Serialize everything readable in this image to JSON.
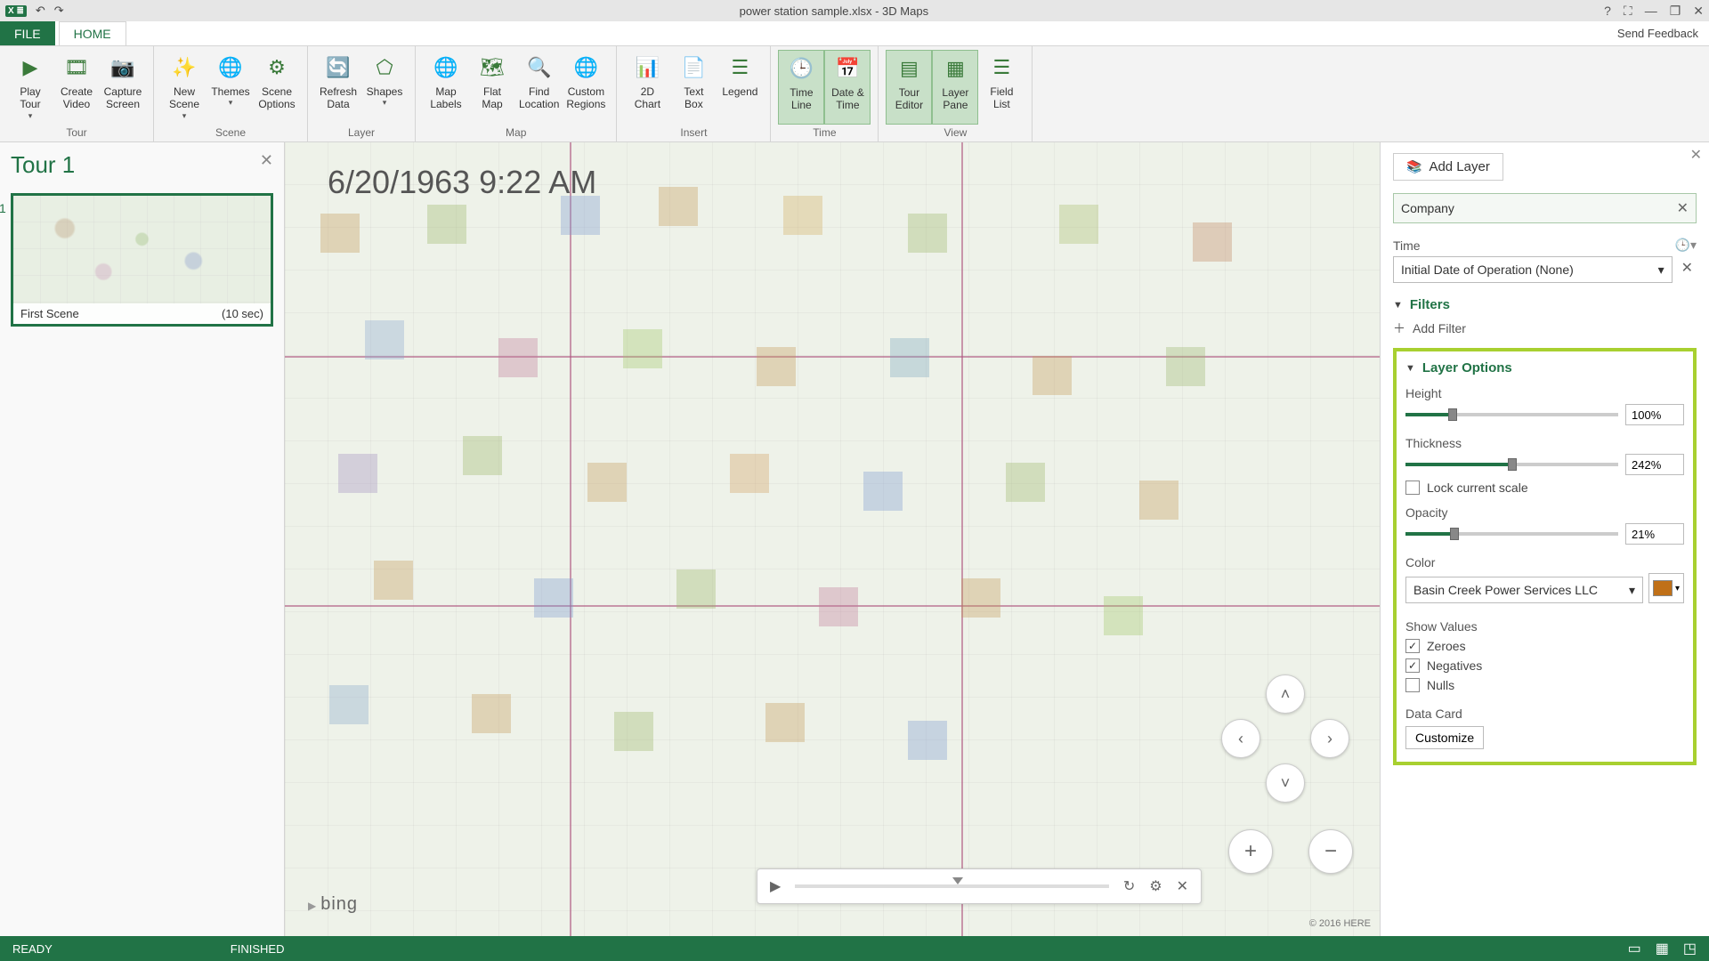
{
  "titlebar": {
    "title": "power station sample.xlsx - 3D Maps"
  },
  "tabs": {
    "file": "FILE",
    "home": "HOME",
    "feedback": "Send Feedback"
  },
  "ribbon": {
    "tour": {
      "label": "Tour",
      "play": "Play\nTour",
      "create": "Create\nVideo",
      "capture": "Capture\nScreen"
    },
    "scene": {
      "label": "Scene",
      "new": "New\nScene",
      "themes": "Themes",
      "options": "Scene\nOptions"
    },
    "layer": {
      "label": "Layer",
      "refresh": "Refresh\nData",
      "shapes": "Shapes"
    },
    "map": {
      "label": "Map",
      "labels": "Map\nLabels",
      "flat": "Flat\nMap",
      "find": "Find\nLocation",
      "custom": "Custom\nRegions"
    },
    "insert": {
      "label": "Insert",
      "chart": "2D\nChart",
      "text": "Text\nBox",
      "legend": "Legend"
    },
    "time": {
      "label": "Time",
      "timeline": "Time\nLine",
      "datetime": "Date &\nTime"
    },
    "view": {
      "label": "View",
      "editor": "Tour\nEditor",
      "pane": "Layer\nPane",
      "list": "Field\nList"
    }
  },
  "tourpanel": {
    "title": "Tour 1",
    "scene_num": "1",
    "scene_name": "First Scene",
    "scene_dur": "(10 sec)"
  },
  "map": {
    "datestamp": "6/20/1963 9:22 AM",
    "bing": "bing",
    "copyright": "© 2016 HERE"
  },
  "layer": {
    "add": "Add Layer",
    "company": "Company",
    "time_lbl": "Time",
    "time_field": "Initial Date of Operation (None)",
    "filters": "Filters",
    "addfilter": "Add Filter",
    "options": "Layer Options",
    "height_lbl": "Height",
    "height_val": "100%",
    "thickness_lbl": "Thickness",
    "thickness_val": "242%",
    "lock": "Lock current scale",
    "opacity_lbl": "Opacity",
    "opacity_val": "21%",
    "color_lbl": "Color",
    "color_field": "Basin Creek Power Services LLC",
    "showvals": "Show Values",
    "zeroes": "Zeroes",
    "negatives": "Negatives",
    "nulls": "Nulls",
    "datacard": "Data Card",
    "customize": "Customize"
  },
  "status": {
    "ready": "READY",
    "finished": "FINISHED"
  }
}
